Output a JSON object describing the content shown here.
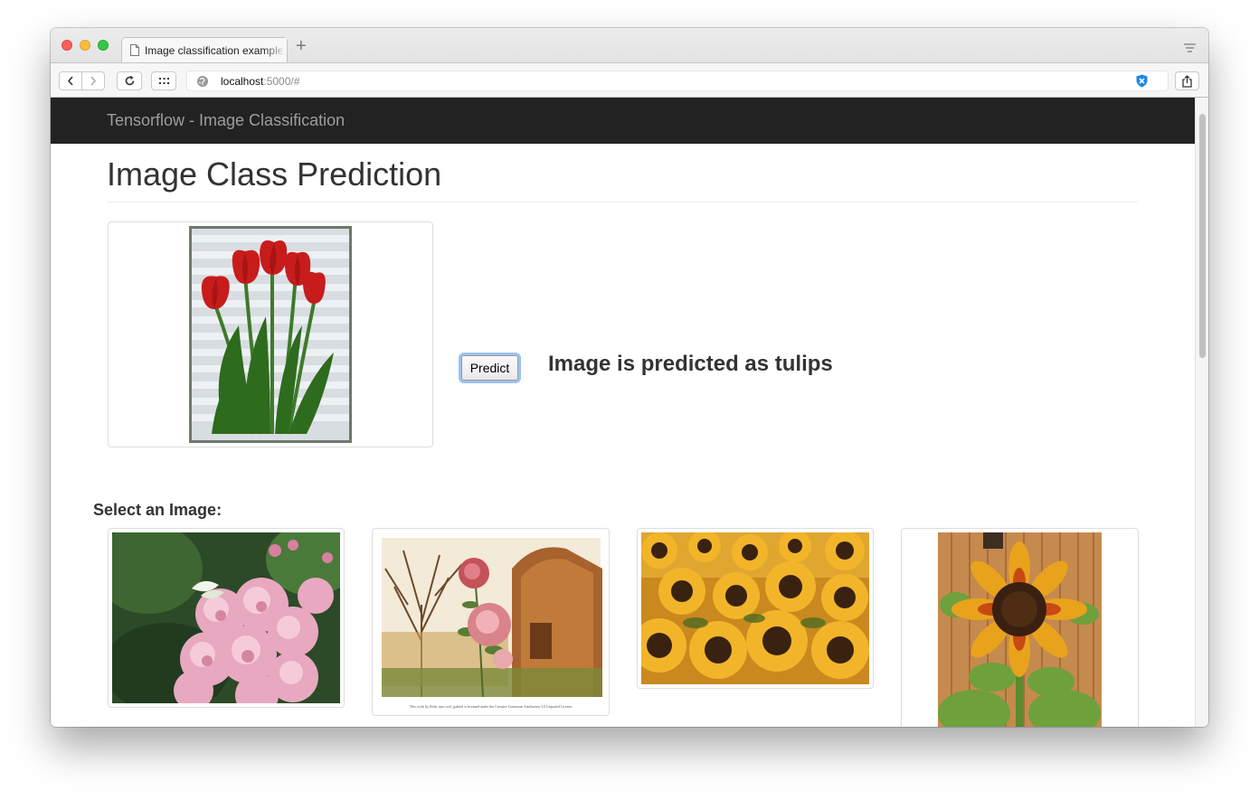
{
  "browser": {
    "tab_title": "Image classification example",
    "new_tab_symbol": "+",
    "url_host": "localhost",
    "url_rest": ":5000/#"
  },
  "page": {
    "brand": "Tensorflow - Image Classification",
    "heading": "Image Class Prediction",
    "predict_label": "Predict",
    "result_text": "Image is predicted as tulips",
    "select_label": "Select an Image:",
    "main_image": "red-tulips",
    "gallery": [
      {
        "subject": "pink-roses"
      },
      {
        "subject": "rose-painting",
        "caption": "This work by flickr user cool_gabriel is licensed under the Creative Commons Attribution 3.0 Unported License."
      },
      {
        "subject": "sunflower-field"
      },
      {
        "subject": "single-sunflower"
      }
    ]
  },
  "colors": {
    "navbar": "#222222",
    "brand_text": "#9d9d9d",
    "heading_text": "#333333",
    "focus_ring": "#9cc3f0"
  }
}
